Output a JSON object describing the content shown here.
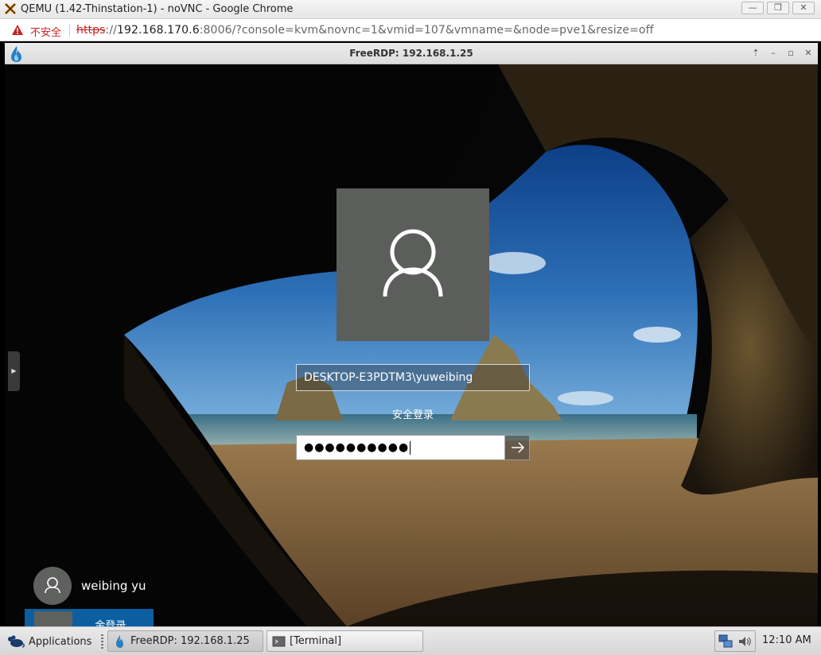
{
  "browser": {
    "window_title": "QEMU (1.42-Thinstation-1) - noVNC - Google Chrome",
    "security_label": "不安全",
    "url_scheme": "https",
    "url_sep": "://",
    "url_host": "192.168.170.6",
    "url_rest": ":8006/?console=kvm&novnc=1&vmid=107&vmname=&node=pve1&resize=off"
  },
  "rdp": {
    "window_title": "FreeRDP: 192.168.1.25"
  },
  "login": {
    "username": "DESKTOP-E3PDTM3\\yuweibing",
    "secure_sign_in": "安全登录",
    "password_mask": "●●●●●●●●●●"
  },
  "users": {
    "primary_name": "weibing yu",
    "secondary_name": "...金登录"
  },
  "taskbar": {
    "applications_label": "Applications",
    "items": [
      "FreeRDP: 192.168.1.25",
      "[Terminal]"
    ],
    "clock": "12:10 AM"
  },
  "colors": {
    "insecure_red": "#c5221f",
    "avatar_gray": "#5b5e5b",
    "selected_user_blue": "#0b5fa1"
  }
}
